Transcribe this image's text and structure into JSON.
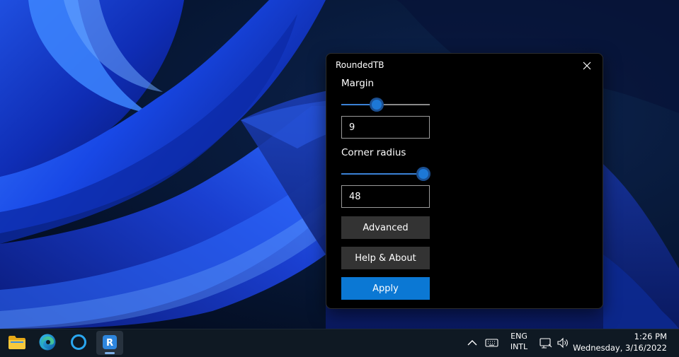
{
  "window": {
    "title": "RoundedTB",
    "margin": {
      "label": "Margin",
      "slider_fraction": 0.4,
      "value": "9"
    },
    "corner_radius": {
      "label": "Corner radius",
      "slider_fraction": 0.93,
      "value": "48"
    },
    "buttons": {
      "advanced": "Advanced",
      "help_about": "Help & About",
      "apply": "Apply"
    }
  },
  "taskbar": {
    "apps": [
      {
        "name": "file-explorer",
        "icon": "folder-icon"
      },
      {
        "name": "edge",
        "icon": "edge-icon"
      },
      {
        "name": "cortana",
        "icon": "cortana-ring-icon"
      },
      {
        "name": "roundedtb",
        "icon": "roundedtb-icon",
        "glyph": "R",
        "active": true
      }
    ],
    "tray": {
      "language_line1": "ENG",
      "language_line2": "INTL",
      "time": "1:26 PM",
      "date": "Wednesday, 3/16/2022"
    }
  },
  "colors": {
    "accent": "#0b78d4",
    "button_bg": "#333333",
    "window_bg": "#000000",
    "taskbar_bg": "#0f1923"
  }
}
